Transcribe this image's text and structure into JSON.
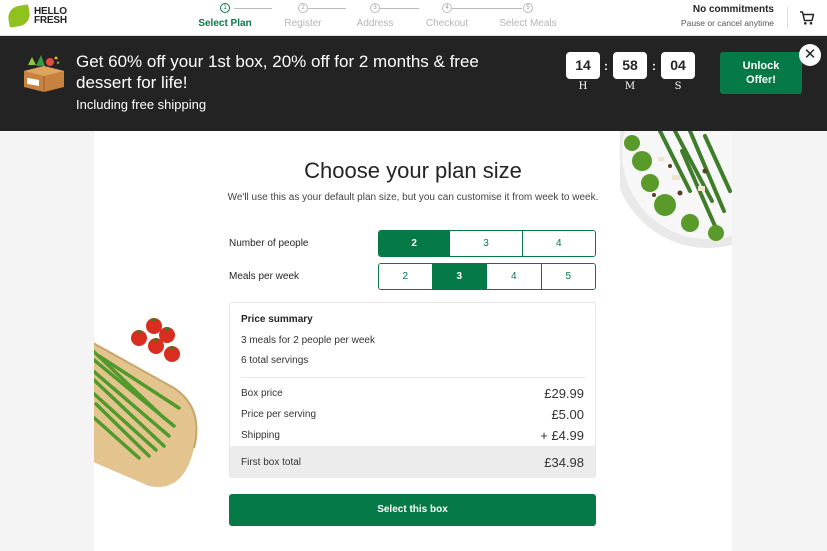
{
  "brand": {
    "logo_text": "HELLO FRESH"
  },
  "steps": [
    {
      "num": "1",
      "label": "Select Plan",
      "active": true
    },
    {
      "num": "2",
      "label": "Register",
      "active": false
    },
    {
      "num": "3",
      "label": "Address",
      "active": false
    },
    {
      "num": "4",
      "label": "Checkout",
      "active": false
    },
    {
      "num": "5",
      "label": "Select Meals",
      "active": false
    }
  ],
  "header": {
    "commit_title": "No commitments",
    "commit_sub": "Pause or cancel anytime",
    "cart_icon": "cart-icon"
  },
  "promo": {
    "headline": "Get 60% off your 1st box, 20% off for 2 months & free dessert for life!",
    "subline": "Including free shipping",
    "timer": {
      "hours": "14",
      "minutes": "58",
      "seconds": "04",
      "h_label": "H",
      "m_label": "M",
      "s_label": "S"
    },
    "cta": "Unlock Offer!",
    "close_icon": "close-icon"
  },
  "plan": {
    "title": "Choose your plan size",
    "subtitle": "We'll use this as your default plan size, but you can customise it from week to week.",
    "people_label": "Number of people",
    "people_options": [
      "2",
      "3",
      "4"
    ],
    "people_selected": "2",
    "meals_label": "Meals per week",
    "meals_options": [
      "2",
      "3",
      "4",
      "5"
    ],
    "meals_selected": "3"
  },
  "summary": {
    "title": "Price summary",
    "line1": "3 meals for 2 people per week",
    "line2": "6 total servings",
    "box_price_label": "Box price",
    "box_price": "£29.99",
    "per_serving_label": "Price per serving",
    "per_serving": "£5.00",
    "shipping_label": "Shipping",
    "shipping": "+ £4.99",
    "total_label": "First box total",
    "total": "£34.98"
  },
  "select_button": "Select this box",
  "colors": {
    "brand_green": "#067a46",
    "logo_green": "#91c11e",
    "banner_bg": "#232323"
  }
}
